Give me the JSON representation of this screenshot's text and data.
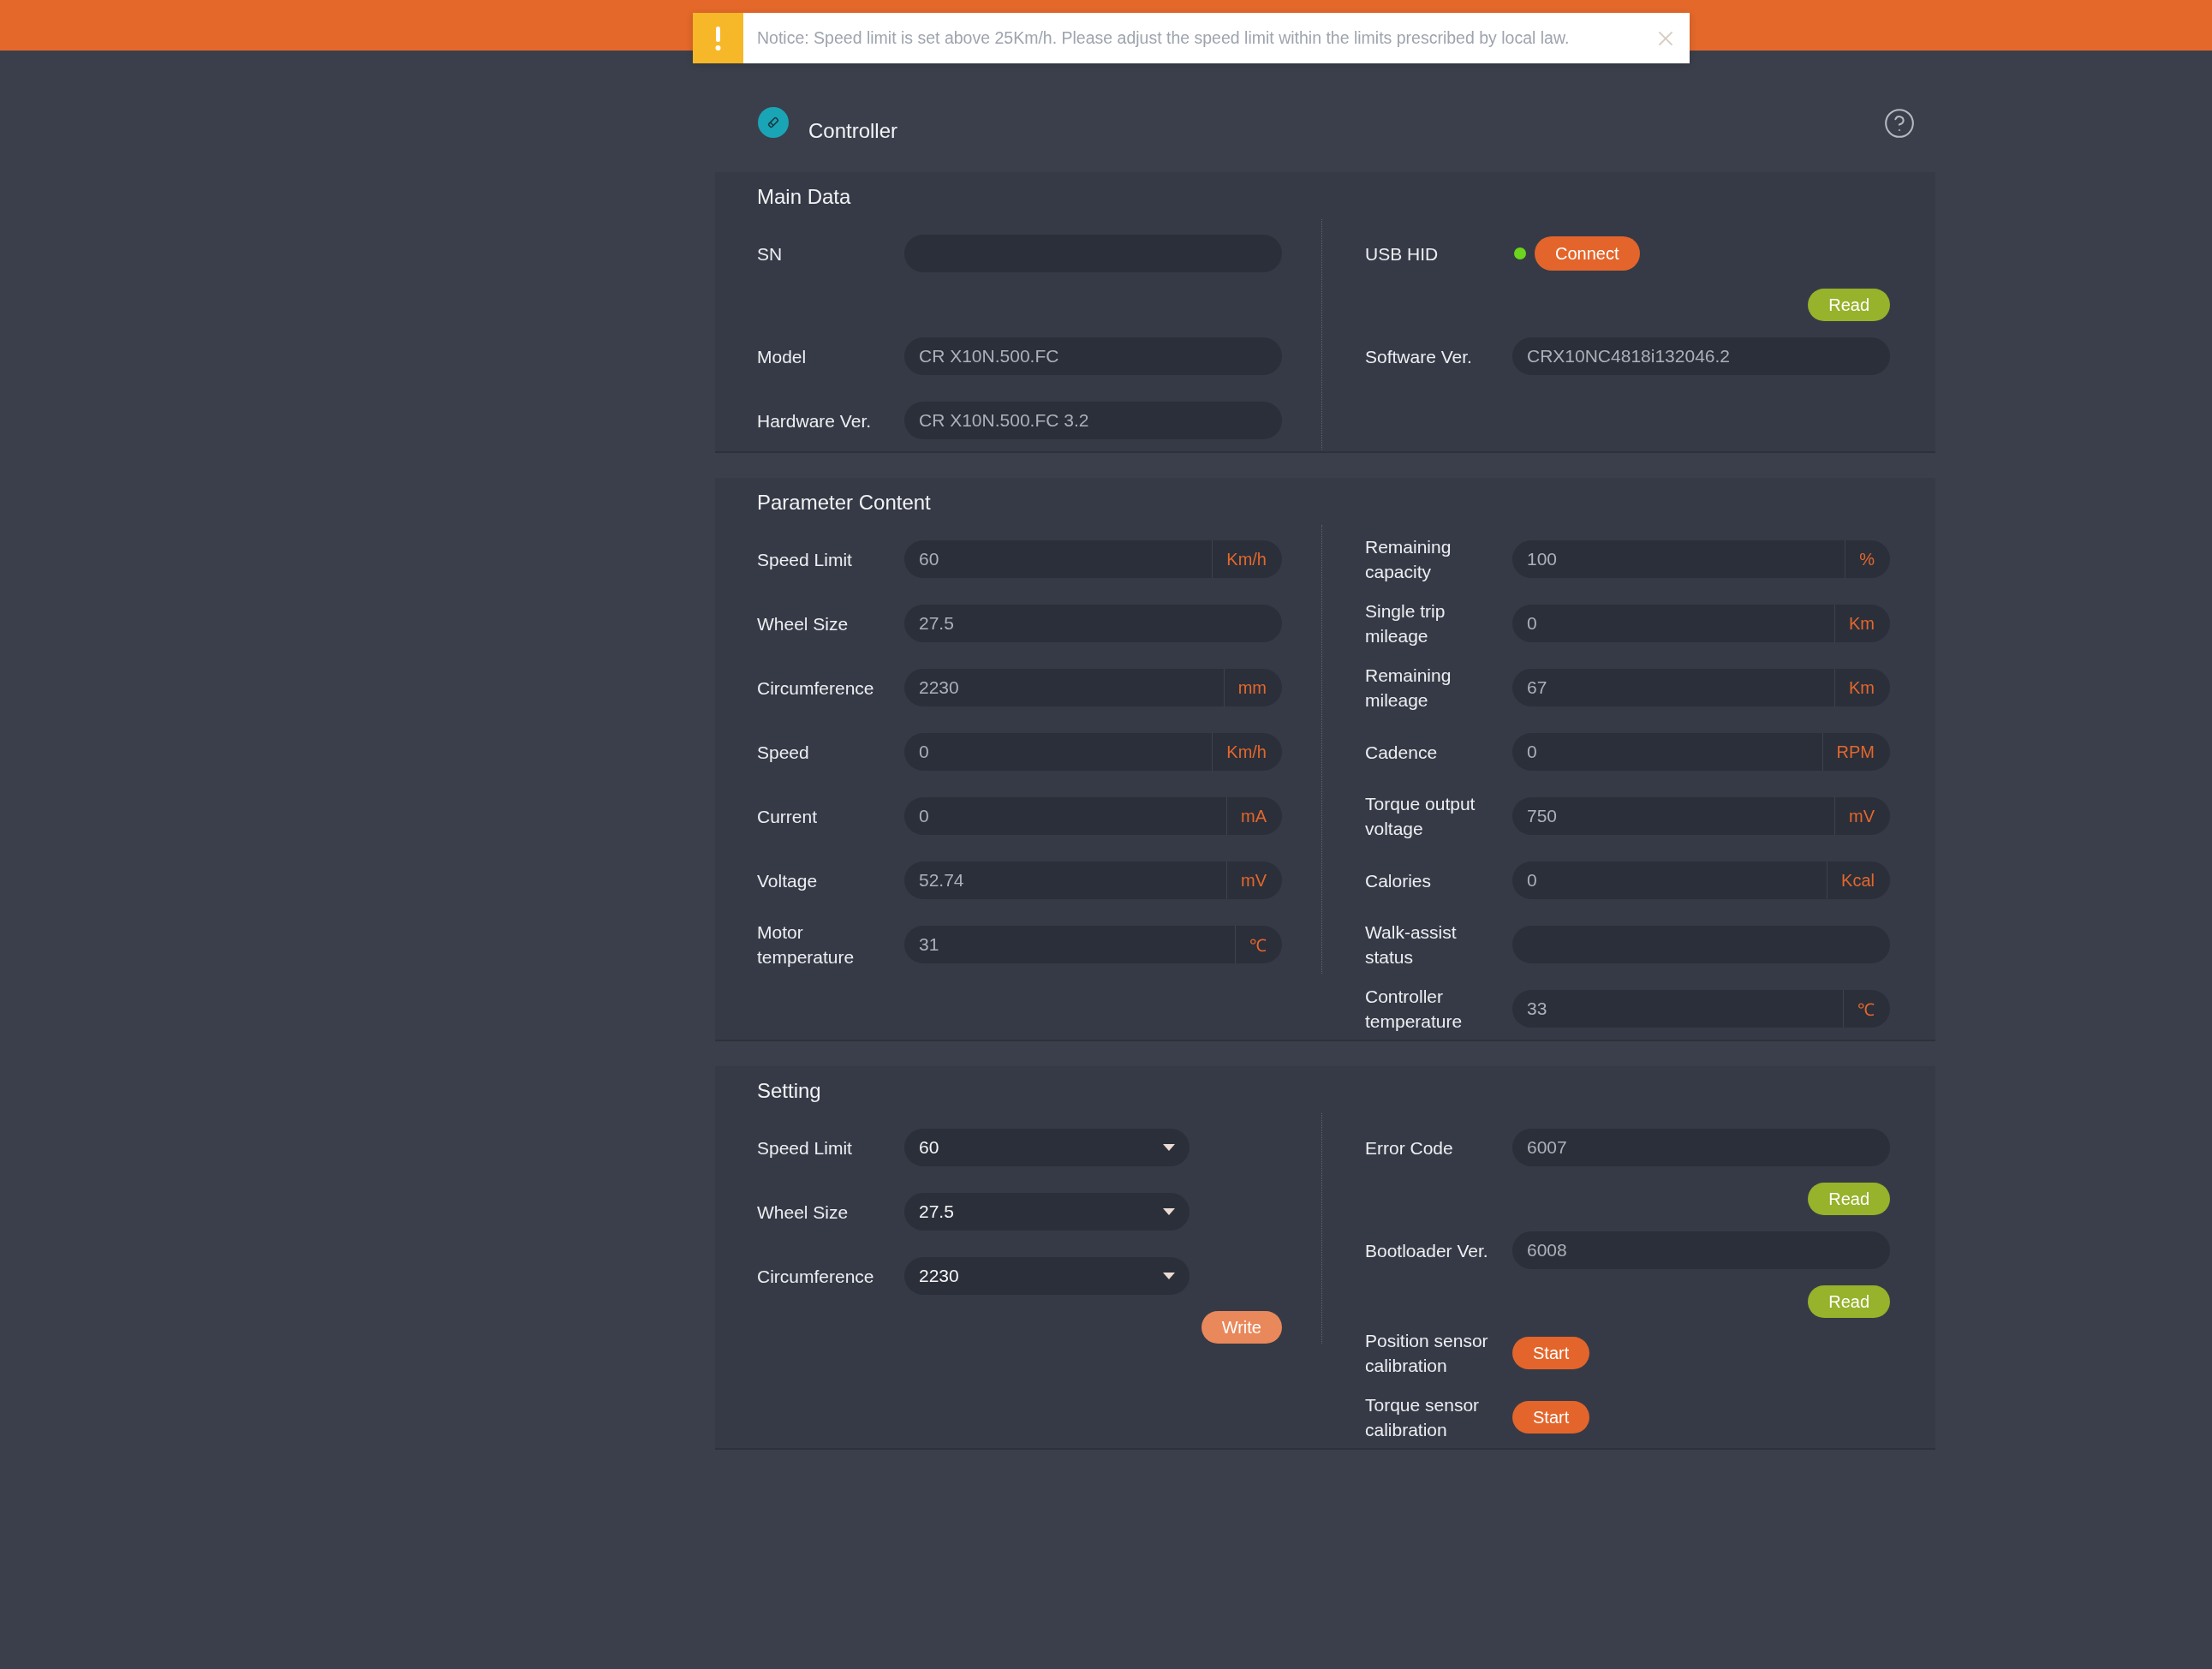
{
  "notice": {
    "message": "Notice: Speed limit is set above 25Km/h. Please adjust the speed limit within the limits prescribed by local law."
  },
  "header": {
    "title": "Controller"
  },
  "main_data": {
    "title": "Main Data",
    "left": [
      {
        "kind": "field",
        "label": "SN"
      },
      {
        "kind": "field",
        "label": "Model",
        "value": "CR X10N.500.FC"
      },
      {
        "kind": "field",
        "label": "Hardware Ver.",
        "value": "CR X10N.500.FC 3.2"
      }
    ],
    "right": [
      {
        "kind": "status",
        "label": "USB HID",
        "online": true,
        "button": "Connect"
      },
      {
        "kind": "read",
        "label": "Read",
        "disabled": false
      },
      {
        "kind": "field",
        "label": "Software Ver.",
        "value": "CRX10NC4818i132046.2"
      }
    ]
  },
  "parameter_content": {
    "title": "Parameter Content",
    "left": [
      {
        "kind": "field",
        "label": "Speed Limit",
        "value": "60",
        "unit": "Km/h"
      },
      {
        "kind": "field",
        "label": "Wheel Size",
        "value": "27.5"
      },
      {
        "kind": "field",
        "label": "Circumference",
        "value": "2230",
        "unit": "mm"
      },
      {
        "kind": "field",
        "label": "Speed",
        "value": "0",
        "unit": "Km/h"
      },
      {
        "kind": "field",
        "label": "Current",
        "value": "0",
        "unit": "mA"
      },
      {
        "kind": "field",
        "label": "Voltage",
        "value": "52.74",
        "unit": "mV"
      },
      {
        "kind": "field",
        "label": "Motor temperature",
        "value": "31",
        "unit": "℃"
      }
    ],
    "right": [
      {
        "kind": "field",
        "label": "Remaining capacity",
        "value": "100",
        "unit": "%"
      },
      {
        "kind": "field",
        "label": "Single trip mileage",
        "value": "0",
        "unit": "Km"
      },
      {
        "kind": "field",
        "label": "Remaining mileage",
        "value": "67",
        "unit": "Km"
      },
      {
        "kind": "field",
        "label": "Cadence",
        "value": "0",
        "unit": "RPM"
      },
      {
        "kind": "field",
        "label": "Torque output voltage",
        "value": "750",
        "unit": "mV"
      },
      {
        "kind": "field",
        "label": "Calories",
        "value": "0",
        "unit": "Kcal"
      },
      {
        "kind": "field",
        "label": "Walk-assist status"
      },
      {
        "kind": "field",
        "label": "Controller temperature",
        "value": "33",
        "unit": "℃"
      }
    ]
  },
  "setting": {
    "title": "Setting",
    "left": [
      {
        "kind": "select",
        "label": "Speed Limit",
        "value": "60"
      },
      {
        "kind": "select",
        "label": "Wheel Size",
        "value": "27.5"
      },
      {
        "kind": "select",
        "label": "Circumference",
        "value": "2230"
      },
      {
        "kind": "write",
        "label": "Write",
        "disabled": true
      }
    ],
    "right": [
      {
        "kind": "field",
        "label": "Error Code",
        "value": "6007"
      },
      {
        "kind": "read",
        "label": "Read",
        "disabled": false
      },
      {
        "kind": "field",
        "label": "Bootloader Ver.",
        "value": "6008"
      },
      {
        "kind": "read",
        "label": "Read",
        "disabled": false
      },
      {
        "kind": "action",
        "label": "Position sensor calibration",
        "button": "Start"
      },
      {
        "kind": "action",
        "label": "Torque sensor calibration",
        "button": "Start"
      }
    ]
  }
}
